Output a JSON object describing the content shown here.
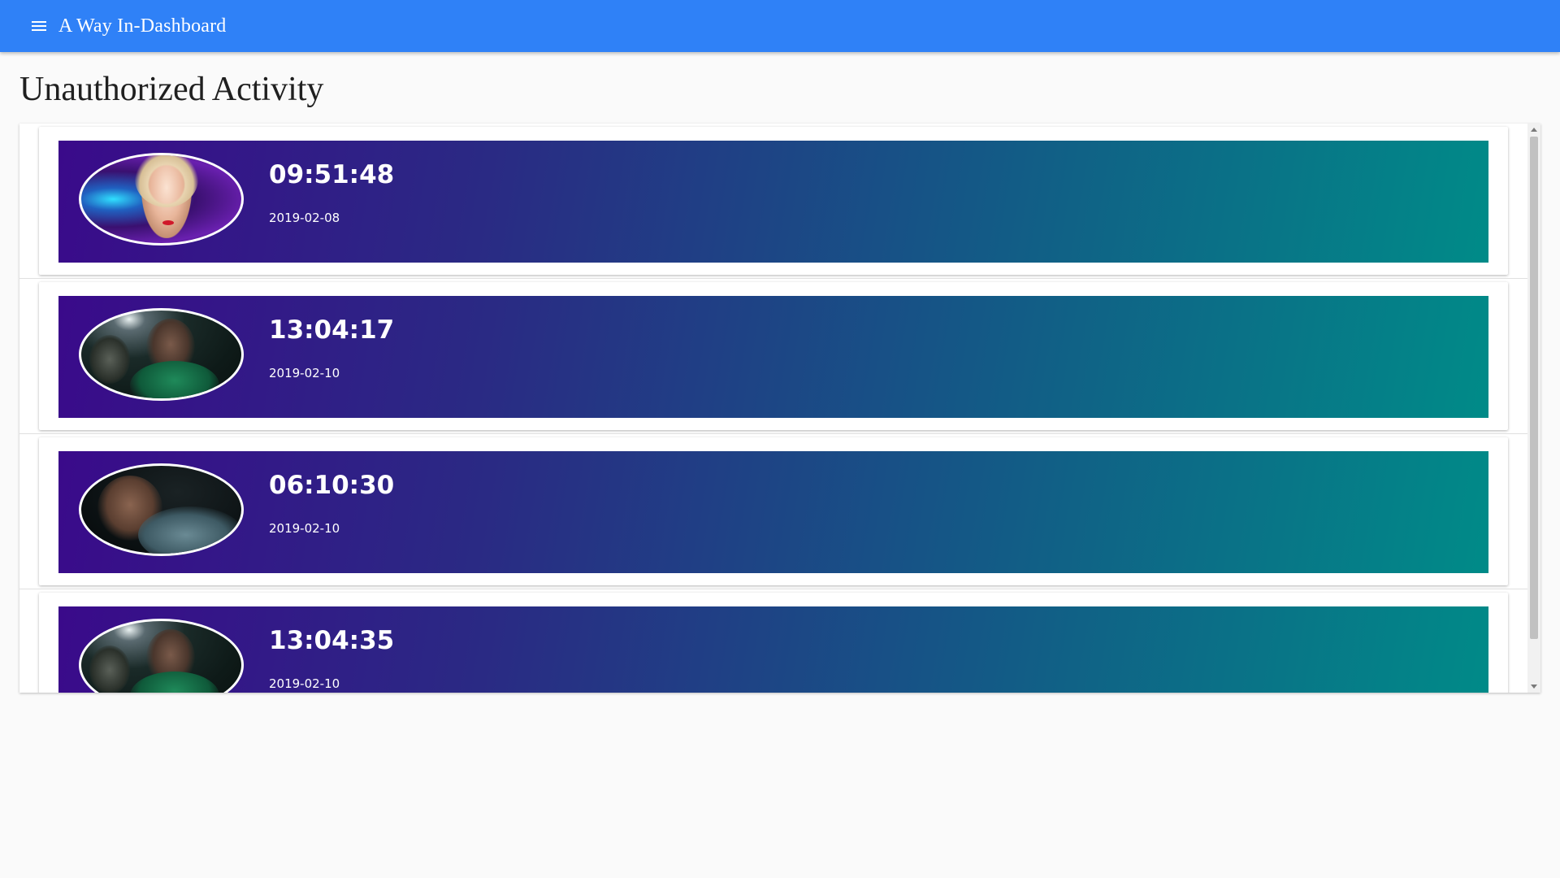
{
  "appbar": {
    "title": "A Way In-Dashboard",
    "menu_icon": "menu-icon",
    "color": "#2f81f7"
  },
  "page": {
    "title": "Unauthorized Activity"
  },
  "activities": [
    {
      "time": "09:51:48",
      "date": "2019-02-08",
      "avatar_icon": "person-photo-icon"
    },
    {
      "time": "13:04:17",
      "date": "2019-02-10",
      "avatar_icon": "person-photo-icon"
    },
    {
      "time": "06:10:30",
      "date": "2019-02-10",
      "avatar_icon": "person-photo-icon"
    },
    {
      "time": "13:04:35",
      "date": "2019-02-10",
      "avatar_icon": "person-photo-icon"
    }
  ],
  "colors": {
    "gradient_start": "#3a0a8a",
    "gradient_end": "#008b88"
  }
}
